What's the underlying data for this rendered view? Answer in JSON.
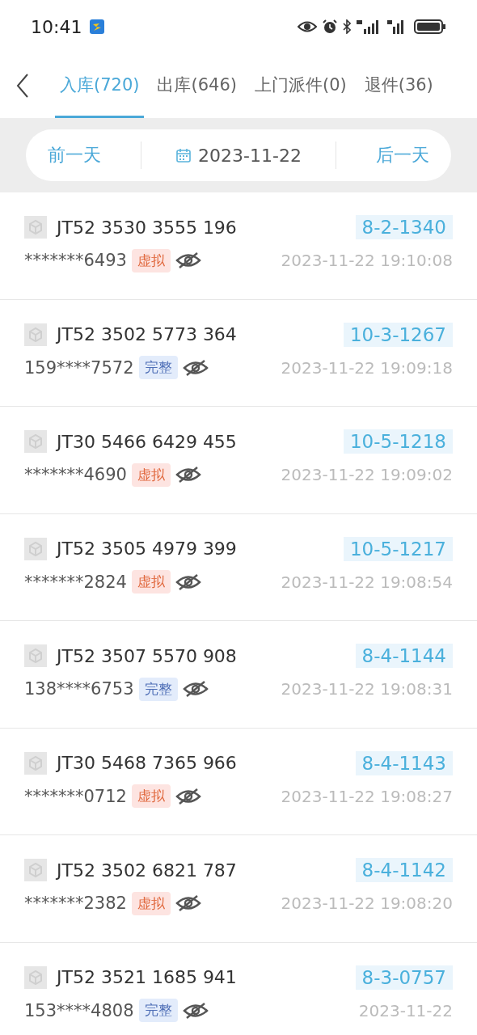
{
  "status_bar": {
    "time": "10:41"
  },
  "tabs": [
    {
      "label": "入库(720)",
      "selected": true
    },
    {
      "label": "出库(646)",
      "selected": false
    },
    {
      "label": "上门派件(0)",
      "selected": false
    },
    {
      "label": "退件(36)",
      "selected": false
    }
  ],
  "date_bar": {
    "prev": "前一天",
    "date": "2023-11-22",
    "next": "后一天"
  },
  "rows": [
    {
      "tracking": "JT52 3530 3555 196",
      "phone": "*******6493",
      "tag": "虚拟",
      "kind": "virtual",
      "code": "8-2-1340",
      "time": "2023-11-22 19:10:08"
    },
    {
      "tracking": "JT52 3502 5773 364",
      "phone": "159****7572",
      "tag": "完整",
      "kind": "full",
      "code": "10-3-1267",
      "time": "2023-11-22 19:09:18"
    },
    {
      "tracking": "JT30 5466 6429 455",
      "phone": "*******4690",
      "tag": "虚拟",
      "kind": "virtual",
      "code": "10-5-1218",
      "time": "2023-11-22 19:09:02"
    },
    {
      "tracking": "JT52 3505 4979 399",
      "phone": "*******2824",
      "tag": "虚拟",
      "kind": "virtual",
      "code": "10-5-1217",
      "time": "2023-11-22 19:08:54"
    },
    {
      "tracking": "JT52 3507 5570 908",
      "phone": "138****6753",
      "tag": "完整",
      "kind": "full",
      "code": "8-4-1144",
      "time": "2023-11-22 19:08:31"
    },
    {
      "tracking": "JT30 5468 7365 966",
      "phone": "*******0712",
      "tag": "虚拟",
      "kind": "virtual",
      "code": "8-4-1143",
      "time": "2023-11-22 19:08:27"
    },
    {
      "tracking": "JT52 3502 6821 787",
      "phone": "*******2382",
      "tag": "虚拟",
      "kind": "virtual",
      "code": "8-4-1142",
      "time": "2023-11-22 19:08:20"
    },
    {
      "tracking": "JT52 3521 1685 941",
      "phone": "153****4808",
      "tag": "完整",
      "kind": "full",
      "code": "8-3-0757",
      "time": "2023-11-22"
    }
  ]
}
